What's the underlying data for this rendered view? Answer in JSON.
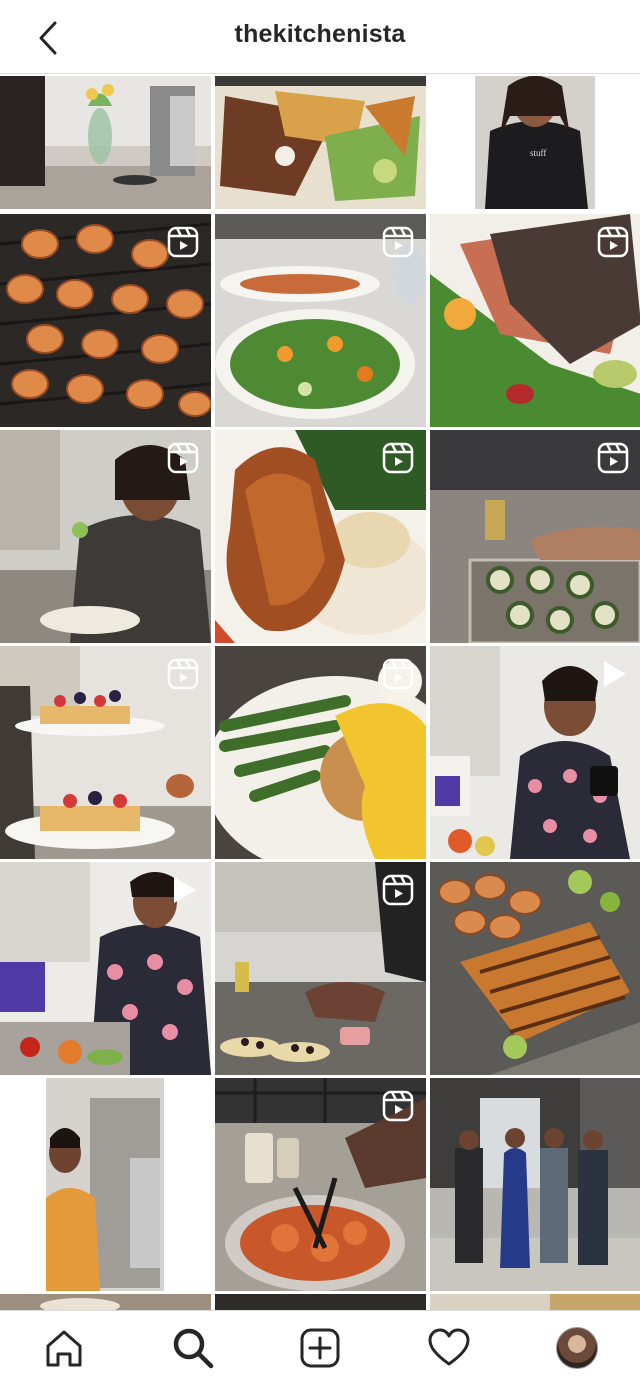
{
  "header": {
    "title": "thekitchenista",
    "back_icon": "chevron-left-icon"
  },
  "grid": {
    "tiles": [
      {
        "row": 0,
        "col": 0,
        "subject": "tulips on kitchen counter",
        "badge": "none"
      },
      {
        "row": 0,
        "col": 1,
        "subject": "grilled chicken salad",
        "badge": "none"
      },
      {
        "row": 0,
        "col": 2,
        "subject": "woman in black apron",
        "badge": "none"
      },
      {
        "row": 1,
        "col": 0,
        "subject": "grilled shrimp",
        "badge": "reel-icon"
      },
      {
        "row": 1,
        "col": 1,
        "subject": "salad spread on counter",
        "badge": "reel-icon"
      },
      {
        "row": 1,
        "col": 2,
        "subject": "seared salmon with arugula",
        "badge": "reel-icon"
      },
      {
        "row": 2,
        "col": 0,
        "subject": "woman tasting food",
        "badge": "reel-icon"
      },
      {
        "row": 2,
        "col": 1,
        "subject": "fried chicken with mashed potatoes",
        "badge": "reel-icon"
      },
      {
        "row": 2,
        "col": 2,
        "subject": "zucchini on sheet pan",
        "badge": "reel-icon"
      },
      {
        "row": 3,
        "col": 0,
        "subject": "pancakes with berries",
        "badge": "reel-icon"
      },
      {
        "row": 3,
        "col": 1,
        "subject": "crab cake with asparagus",
        "badge": "reel-icon"
      },
      {
        "row": 3,
        "col": 2,
        "subject": "woman holding mug",
        "badge": "play-icon"
      },
      {
        "row": 4,
        "col": 0,
        "subject": "woman in floral dress",
        "badge": "play-icon"
      },
      {
        "row": 4,
        "col": 1,
        "subject": "prepping tortillas",
        "badge": "reel-icon"
      },
      {
        "row": 4,
        "col": 2,
        "subject": "grilled shrimp and fish",
        "badge": "none"
      },
      {
        "row": 5,
        "col": 0,
        "subject": "woman in orange apron",
        "badge": "none"
      },
      {
        "row": 5,
        "col": 1,
        "subject": "marinating chicken",
        "badge": "reel-icon"
      },
      {
        "row": 5,
        "col": 2,
        "subject": "group photo outdoors",
        "badge": "none"
      }
    ]
  },
  "tabbar": {
    "items": [
      {
        "name": "home",
        "icon": "home-icon"
      },
      {
        "name": "search",
        "icon": "search-icon"
      },
      {
        "name": "new-post",
        "icon": "add-post-icon"
      },
      {
        "name": "activity",
        "icon": "heart-icon"
      },
      {
        "name": "profile",
        "icon": "profile-avatar"
      }
    ]
  }
}
